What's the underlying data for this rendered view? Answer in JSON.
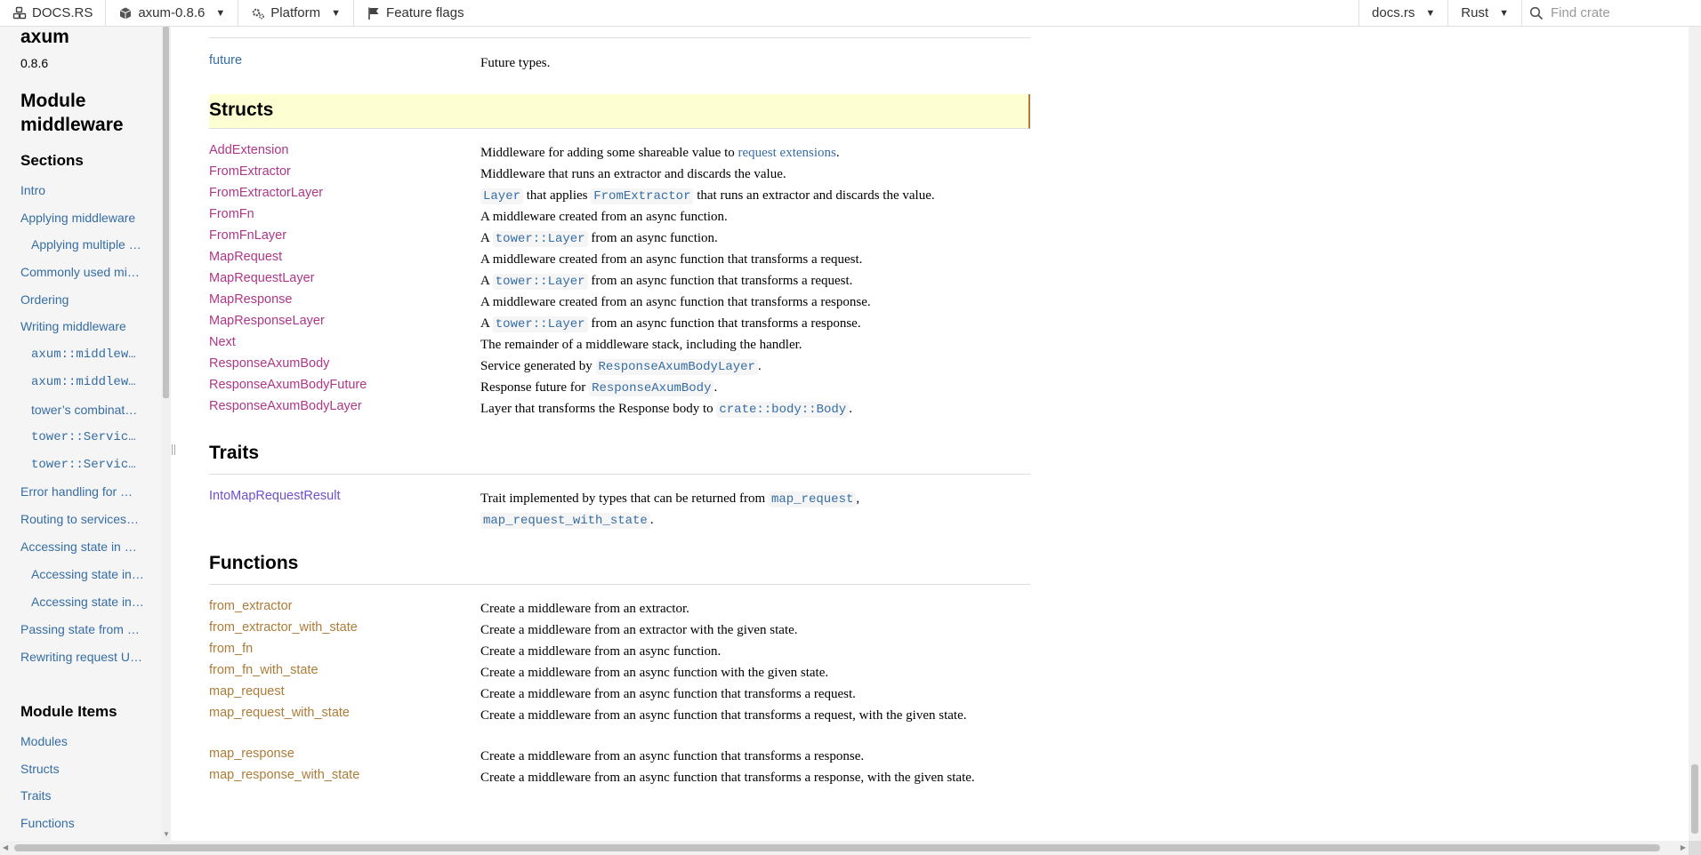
{
  "topnav": {
    "docsrs_label": "DOCS.RS",
    "crate_label": "axum-0.8.6",
    "platform_label": "Platform",
    "feature_flags_label": "Feature flags",
    "docsrs_menu_label": "docs.rs",
    "rust_menu_label": "Rust",
    "search_placeholder": "Find crate"
  },
  "sidebar": {
    "crate_name": "axum",
    "crate_version": "0.8.6",
    "module_title": "Module middleware",
    "sections_heading": "Sections",
    "sections": [
      {
        "label": "Intro"
      },
      {
        "label": "Applying middleware"
      },
      {
        "label": "Applying multiple …"
      },
      {
        "label": "Commonly used mi…"
      },
      {
        "label": "Ordering"
      },
      {
        "label": "Writing middleware"
      },
      {
        "label": "axum::middlew…"
      },
      {
        "label": "axum::middlew…"
      },
      {
        "label": "tower’s combinat…"
      },
      {
        "label": "tower::Servic…"
      },
      {
        "label": "tower::Servic…"
      },
      {
        "label": "Error handling for …"
      },
      {
        "label": "Routing to services…"
      },
      {
        "label": "Accessing state in …"
      },
      {
        "label": "Accessing state in…"
      },
      {
        "label": "Accessing state in…"
      },
      {
        "label": "Passing state from …"
      },
      {
        "label": "Rewriting request U…"
      }
    ],
    "module_items_heading": "Module Items",
    "module_items": [
      {
        "label": "Modules"
      },
      {
        "label": "Structs"
      },
      {
        "label": "Traits"
      },
      {
        "label": "Functions"
      }
    ]
  },
  "main": {
    "modules": [
      {
        "name": "future",
        "desc": "Future types."
      }
    ],
    "structs_heading": "Structs",
    "structs": [
      {
        "name": "AddExtension",
        "desc_pre": "Middleware for adding some shareable value to ",
        "desc_link": "request extensions",
        "desc_post": "."
      },
      {
        "name": "FromExtractor",
        "desc": "Middleware that runs an extractor and discards the value."
      },
      {
        "name": "FromExtractorLayer",
        "code1": "Layer",
        "mid": " that applies ",
        "code2": "FromExtractor",
        "post": " that runs an extractor and discards the value."
      },
      {
        "name": "FromFn",
        "desc": "A middleware created from an async function."
      },
      {
        "name": "FromFnLayer",
        "pre": "A ",
        "code": "tower::Layer",
        "post": " from an async function."
      },
      {
        "name": "MapRequest",
        "desc": "A middleware created from an async function that transforms a request."
      },
      {
        "name": "MapRequestLayer",
        "pre": "A ",
        "code": "tower::Layer",
        "post": " from an async function that transforms a request."
      },
      {
        "name": "MapResponse",
        "desc": "A middleware created from an async function that transforms a response."
      },
      {
        "name": "MapResponseLayer",
        "pre": "A ",
        "code": "tower::Layer",
        "post": " from an async function that transforms a response."
      },
      {
        "name": "Next",
        "desc": "The remainder of a middleware stack, including the handler."
      },
      {
        "name": "ResponseAxumBody",
        "pre": "Service generated by ",
        "code": "ResponseAxumBodyLayer",
        "post": "."
      },
      {
        "name": "ResponseAxumBodyFuture",
        "pre": "Response future for ",
        "code": "ResponseAxumBody",
        "post": "."
      },
      {
        "name": "ResponseAxumBodyLayer",
        "pre": "Layer that transforms the Response body to ",
        "code": "crate::body::Body",
        "post": "."
      }
    ],
    "traits_heading": "Traits",
    "traits": [
      {
        "name": "IntoMapRequestResult",
        "pre": "Trait implemented by types that can be returned from ",
        "code1": "map_request",
        "mid": ",",
        "code2": "map_request_with_state",
        "post": "."
      }
    ],
    "functions_heading": "Functions",
    "functions": [
      {
        "name": "from_extractor",
        "desc": "Create a middleware from an extractor."
      },
      {
        "name": "from_extractor_with_state",
        "desc": "Create a middleware from an extractor with the given state."
      },
      {
        "name": "from_fn",
        "desc": "Create a middleware from an async function."
      },
      {
        "name": "from_fn_with_state",
        "desc": "Create a middleware from an async function with the given state."
      },
      {
        "name": "map_request",
        "desc": "Create a middleware from an async function that transforms a request."
      },
      {
        "name": "map_request_with_state",
        "desc": "Create a middleware from an async function that transforms a request, with the given state."
      },
      {
        "name": "map_response",
        "desc": "Create a middleware from an async function that transforms a response."
      },
      {
        "name": "map_response_with_state",
        "desc": "Create a middleware from an async function that transforms a response, with the given state."
      }
    ]
  }
}
